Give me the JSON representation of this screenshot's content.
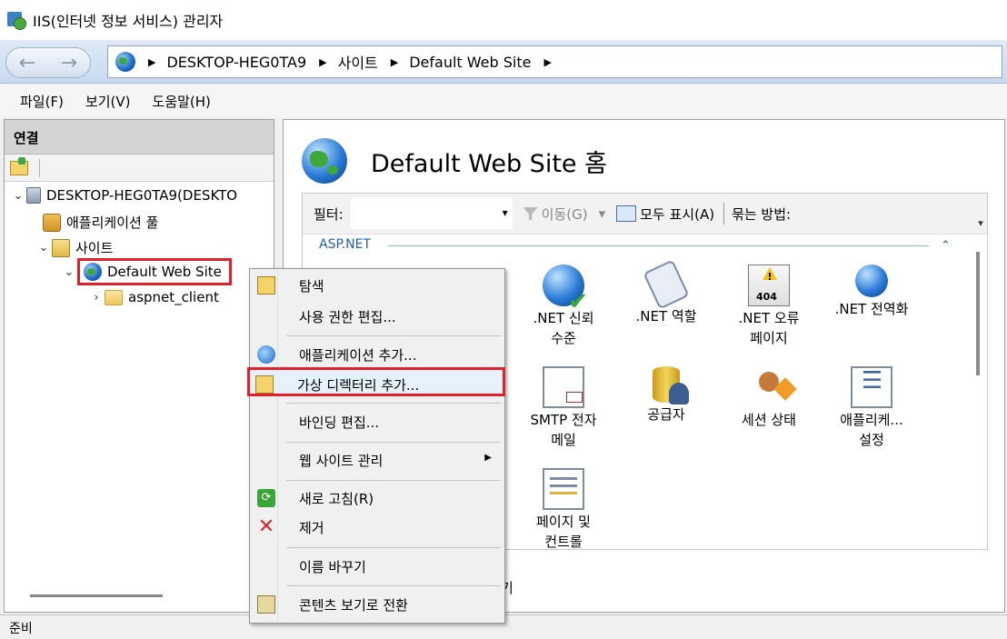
{
  "window": {
    "title": "IIS(인터넷 정보 서비스) 관리자"
  },
  "address": {
    "crumbs": [
      "DESKTOP-HEG0TA9",
      "사이트",
      "Default Web Site"
    ]
  },
  "menu": {
    "file": "파일(F)",
    "view": "보기(V)",
    "help": "도움말(H)"
  },
  "connections": {
    "header": "연결",
    "tree": {
      "server": "DESKTOP-HEG0TA9(DESKTO",
      "app_pools": "애플리케이션 풀",
      "sites": "사이트",
      "site": "Default Web Site",
      "child": "aspnet_client"
    }
  },
  "main": {
    "title": "Default Web Site 홈",
    "filter_label": "필터:",
    "go": "이동(G)",
    "show_all": "모두 표시(A)",
    "group_by": "묶는 방법:",
    "section": "ASP.NET",
    "features": [
      {
        "label": ".NET 신뢰\n수준",
        "icon": "trust-level-icon"
      },
      {
        "label": ".NET 역할",
        "icon": "roles-icon"
      },
      {
        "label": ".NET 오류\n페이지",
        "icon": "error-pages-icon"
      },
      {
        "label": ".NET 전역화",
        "icon": "globalization-icon"
      },
      {
        "label": "SMTP 전자\n메일",
        "icon": "smtp-email-icon"
      },
      {
        "label": "공급자",
        "icon": "providers-icon"
      },
      {
        "label": "세션 상태",
        "icon": "session-state-icon"
      },
      {
        "label": "애플리케...\n설정",
        "icon": "app-settings-icon"
      },
      {
        "label": "페이지 및\n컨트롤",
        "icon": "pages-controls-icon"
      }
    ],
    "partial_text": "기"
  },
  "context_menu": {
    "explore": "탐색",
    "edit_permissions": "사용 권한 편집...",
    "add_application": "애플리케이션 추가...",
    "add_virtual_dir": "가상 디렉터리 추가...",
    "edit_bindings": "바인딩 편집...",
    "manage_site": "웹 사이트 관리",
    "refresh": "새로 고침(R)",
    "remove": "제거",
    "rename": "이름 바꾸기",
    "switch_content": "콘텐츠 보기로 전환"
  },
  "status": {
    "text": "준비"
  }
}
